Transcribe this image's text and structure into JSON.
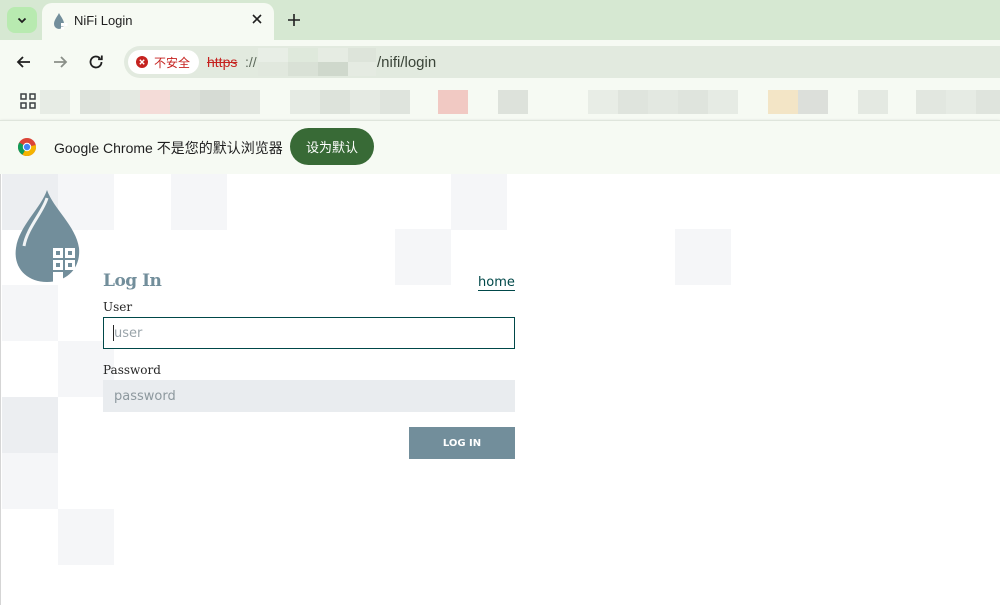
{
  "browser": {
    "tab": {
      "title": "NiFi Login"
    },
    "address": {
      "security_label": "不安全",
      "scheme": "https",
      "separator": "://",
      "path": "/nifi/login"
    },
    "infobar": {
      "message": "Google Chrome 不是您的默认浏览器",
      "button_label": "设为默认"
    }
  },
  "login": {
    "title": "Log In",
    "home_link": "home",
    "user_label": "User",
    "user_placeholder": "user",
    "password_label": "Password",
    "password_placeholder": "password",
    "submit_label": "LOG IN"
  },
  "colors": {
    "tab_bar": "#d6e8d2",
    "toolbar": "#f6faf3",
    "insecure_red": "#c5221f",
    "default_button": "#386a36",
    "nifi_primary": "#728e9b",
    "nifi_focus": "#004849"
  },
  "icons": {
    "tab_menu": "chevron-down-icon",
    "favicon": "nifi-drop-icon",
    "close": "close-icon",
    "new_tab": "plus-icon",
    "back": "arrow-left-icon",
    "forward": "arrow-right-icon",
    "reload": "reload-icon",
    "insecure": "error-circle-icon",
    "apps": "apps-grid-icon",
    "chrome": "chrome-logo-icon",
    "logo": "nifi-logo-icon"
  }
}
